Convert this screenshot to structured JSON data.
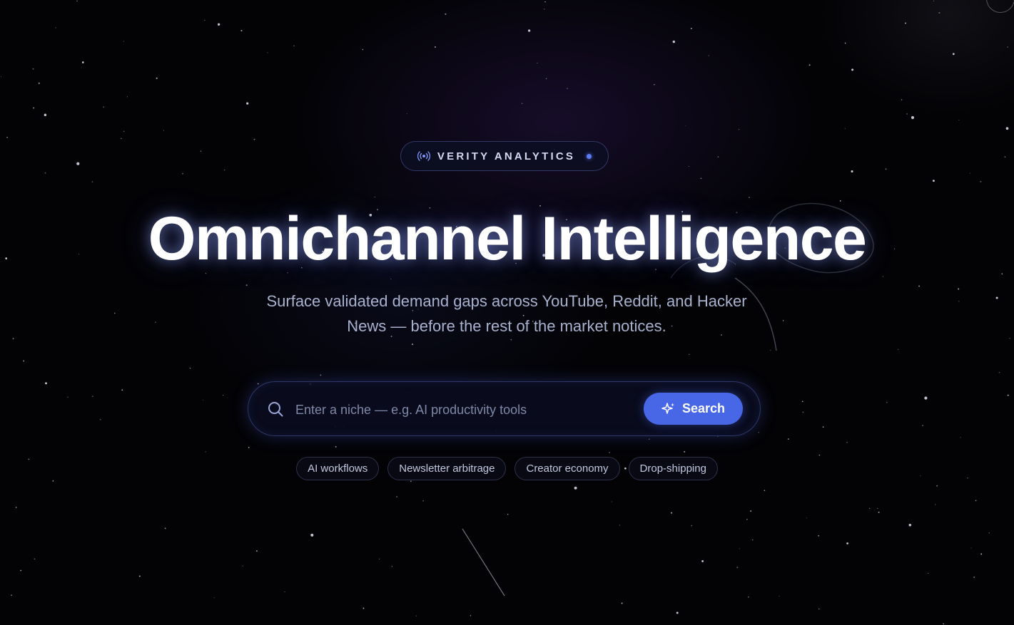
{
  "badge": {
    "icon": "broadcast-icon",
    "label": "VERITY ANALYTICS",
    "status_color": "#5b7cf5"
  },
  "hero": {
    "title": "Omnichannel Intelligence",
    "subtitle": "Surface validated demand gaps across YouTube, Reddit, and Hacker News — before the rest of the market notices."
  },
  "search": {
    "icon": "search-icon",
    "placeholder": "Enter a niche — e.g. AI productivity tools",
    "value": "",
    "button_label": "Search",
    "button_icon": "sparkle-icon",
    "button_color": "#4767e6"
  },
  "suggestions": [
    {
      "label": "AI workflows"
    },
    {
      "label": "Newsletter arbitrage"
    },
    {
      "label": "Creator economy"
    },
    {
      "label": "Drop-shipping"
    }
  ],
  "colors": {
    "background": "#030306",
    "accent": "#4767e6"
  }
}
